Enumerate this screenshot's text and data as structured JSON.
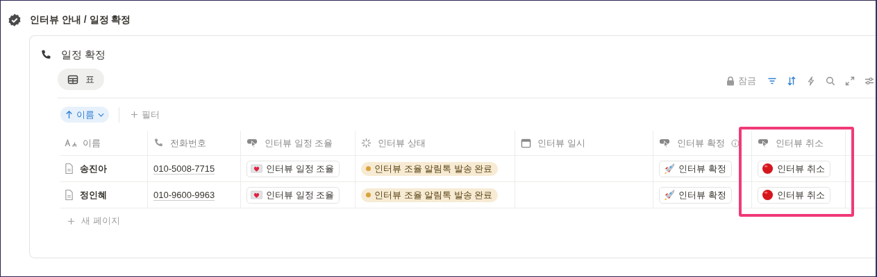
{
  "page": {
    "title": "인터뷰 안내 / 일정 확정"
  },
  "database": {
    "title": "일정 확정",
    "views": [
      {
        "label": "표",
        "selected": true
      }
    ],
    "toolbar": {
      "lock_label": "잠금",
      "tools": [
        {
          "kind": "filter",
          "on": true
        },
        {
          "kind": "sort",
          "on": true
        },
        {
          "kind": "automation",
          "on": false
        },
        {
          "kind": "search",
          "on": false
        },
        {
          "kind": "expand",
          "on": false
        },
        {
          "kind": "settings",
          "on": false
        }
      ]
    },
    "sort_chip": {
      "label": "이름"
    },
    "filter_button": {
      "label": "필터"
    },
    "columns": [
      {
        "label": "이름",
        "kind": "title",
        "info": false
      },
      {
        "label": "전화번호",
        "kind": "phone",
        "info": false
      },
      {
        "label": "인터뷰 일정 조율",
        "kind": "button",
        "info": false
      },
      {
        "label": "인터뷰 상태",
        "kind": "status",
        "info": false
      },
      {
        "label": "인터뷰 일시",
        "kind": "date",
        "info": false
      },
      {
        "label": "인터뷰 확정",
        "kind": "button",
        "info": true
      },
      {
        "label": "인터뷰 취소",
        "kind": "button",
        "info": false
      }
    ],
    "rows": [
      {
        "cells": [
          {
            "text": "송진아"
          },
          {
            "text": "010-5008-7715"
          },
          {
            "text": "인터뷰 일정 조율",
            "kind": "letter"
          },
          {
            "text": "인터뷰 조율 알림톡 발송 완료",
            "color": "#d9a23a"
          },
          {},
          {
            "text": "인터뷰 확정",
            "kind": "rocket"
          },
          {
            "text": "인터뷰 취소",
            "kind": "stop"
          }
        ]
      },
      {
        "cells": [
          {
            "text": "정인혜"
          },
          {
            "text": "010-9600-9963"
          },
          {
            "text": "인터뷰 일정 조율",
            "kind": "letter"
          },
          {
            "text": "인터뷰 조율 알림톡 발송 완료",
            "color": "#d9a23a"
          },
          {},
          {
            "text": "인터뷰 확정",
            "kind": "rocket"
          },
          {
            "text": "인터뷰 취소",
            "kind": "stop"
          }
        ]
      }
    ],
    "new_row": {
      "label": "새 페이지"
    }
  }
}
